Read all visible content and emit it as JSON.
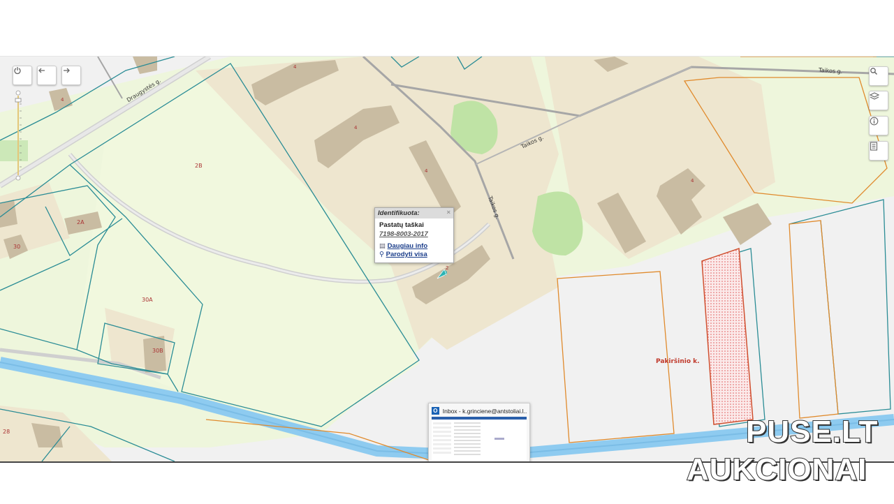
{
  "map": {
    "streets": {
      "draugystes": "Draugystės g.",
      "taikos_top": "Taikos g.",
      "taikos_mid": "Taikos g.",
      "taikos_vertical": "Taikos g."
    },
    "parcel_labels": {
      "p2b": "2B",
      "p2a": "2A",
      "p30": "30",
      "p30a": "30A",
      "p30b": "30B",
      "p28": "28"
    },
    "building_numbers": {
      "b1": "4",
      "b2": "4",
      "b3": "4",
      "b4": "4",
      "b5": "2",
      "b6": "4"
    },
    "area_label": "Pakiršinio k.",
    "area_color": "#c0392b"
  },
  "popup": {
    "header": "Identifikuota:",
    "category": "Pastatų taškai",
    "id": "7198-8003-2017",
    "more_info": "Daugiau info",
    "show_all": "Parodyti visa"
  },
  "controls": {
    "power_icon": "power-icon",
    "back_icon": "arrow-left-icon",
    "forward_icon": "arrow-right-icon",
    "search_icon": "search-icon",
    "layers_icon": "layers-icon",
    "info_icon": "info-icon",
    "legend_icon": "legend-icon"
  },
  "taskbar_preview": {
    "title": "Inbox - k.grinciene@antstoliai.l..."
  },
  "watermark": {
    "line1": "PUSE.LT",
    "line2": "AUKCIONAI"
  }
}
